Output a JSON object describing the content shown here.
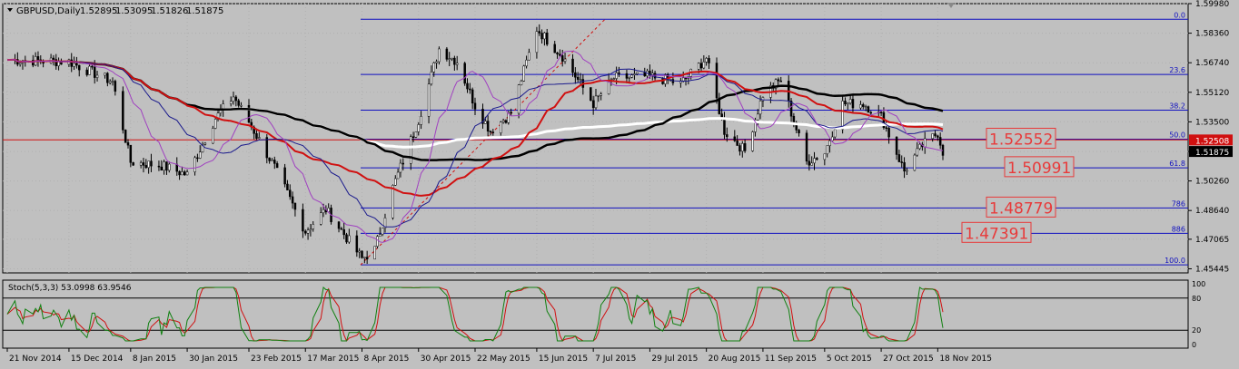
{
  "window": {
    "symbol_header": "GBPUSD,Daily",
    "ohlc": [
      "1.52895",
      "1.53095",
      "1.51826",
      "1.51875"
    ]
  },
  "colors": {
    "background": "#c0c0c0",
    "grid": "#b0b0b0",
    "bull_candle": "#000000",
    "bear_candle": "#000000",
    "ma_white": "#ffffff",
    "ma_black": "#000000",
    "ma_red": "#d01010",
    "ma_navy": "#1a1a8c",
    "ma_purple": "#a040c0",
    "fib": "#1010c0",
    "hline": "#d01010",
    "stoch_main": "#108010",
    "stoch_signal": "#d01010",
    "label_fill": "#e83a3a"
  },
  "chart_data": [
    {
      "type": "candlestick",
      "title": "GBPUSD,Daily",
      "ylim": [
        1.4522,
        1.5998
      ],
      "y_ticks": [
        "1.59980",
        "1.58360",
        "1.56740",
        "1.55120",
        "1.53500",
        "1.51875",
        "1.50260",
        "1.48640",
        "1.47065",
        "1.45445"
      ],
      "current_price_label": "1.51875",
      "bid_label": "1.52508",
      "x_ticks": [
        "21 Nov 2014",
        "15 Dec 2014",
        "8 Jan 2015",
        "30 Jan 2015",
        "23 Feb 2015",
        "17 Mar 2015",
        "8 Apr 2015",
        "30 Apr 2015",
        "22 May 2015",
        "15 Jun 2015",
        "7 Jul 2015",
        "29 Jul 2015",
        "20 Aug 2015",
        "11 Sep 2015",
        "5 Oct 2015",
        "27 Oct 2015",
        "18 Nov 2015"
      ],
      "close_path": [
        [
          "21 Nov 2014",
          1.569
        ],
        [
          "15 Dec 2014",
          1.568
        ],
        [
          "1 Jan 2015",
          1.557
        ],
        [
          "8 Jan 2015",
          1.513
        ],
        [
          "20 Jan 2015",
          1.511
        ],
        [
          "30 Jan 2015",
          1.506
        ],
        [
          "10 Feb 2015",
          1.537
        ],
        [
          "17 Feb 2015",
          1.549
        ],
        [
          "23 Feb 2015",
          1.535
        ],
        [
          "5 Mar 2015",
          1.51
        ],
        [
          "17 Mar 2015",
          1.475
        ],
        [
          "25 Mar 2015",
          1.487
        ],
        [
          "8 Apr 2015",
          1.46
        ],
        [
          "13 Apr 2015",
          1.465
        ],
        [
          "20 Apr 2015",
          1.499
        ],
        [
          "30 Apr 2015",
          1.536
        ],
        [
          "8 May 2015",
          1.575
        ],
        [
          "15 May 2015",
          1.568
        ],
        [
          "22 May 2015",
          1.544
        ],
        [
          "28 May 2015",
          1.53
        ],
        [
          "5 Jun 2015",
          1.54
        ],
        [
          "15 Jun 2015",
          1.586
        ],
        [
          "25 Jun 2015",
          1.571
        ],
        [
          "7 Jul 2015",
          1.545
        ],
        [
          "15 Jul 2015",
          1.559
        ],
        [
          "29 Jul 2015",
          1.56
        ],
        [
          "10 Aug 2015",
          1.556
        ],
        [
          "20 Aug 2015",
          1.57
        ],
        [
          "27 Aug 2015",
          1.53
        ],
        [
          "4 Sep 2015",
          1.519
        ],
        [
          "11 Sep 2015",
          1.55
        ],
        [
          "18 Sep 2015",
          1.558
        ],
        [
          "28 Sep 2015",
          1.513
        ],
        [
          "5 Oct 2015",
          1.518
        ],
        [
          "12 Oct 2015",
          1.545
        ],
        [
          "20 Oct 2015",
          1.545
        ],
        [
          "27 Oct 2015",
          1.538
        ],
        [
          "5 Nov 2015",
          1.508
        ],
        [
          "12 Nov 2015",
          1.522
        ],
        [
          "18 Nov 2015",
          1.529
        ],
        [
          "20 Nov 2015",
          1.5188
        ]
      ],
      "fibonacci": [
        {
          "label": "0.0",
          "value": 1.5912
        },
        {
          "label": "23.6",
          "value": 1.561
        },
        {
          "label": "38.2",
          "value": 1.5414
        },
        {
          "label": "50.0",
          "value": 1.5255
        },
        {
          "label": "61.8",
          "value": 1.5098
        },
        {
          "label": "786",
          "value": 1.4878
        },
        {
          "label": "886",
          "value": 1.4739
        },
        {
          "label": "100.0",
          "value": 1.4566
        }
      ],
      "horizontal_line": 1.5251,
      "price_labels": [
        "1.52552",
        "1.50991",
        "1.48779",
        "1.47391"
      ]
    },
    {
      "type": "line",
      "title": "Stoch(5,3,3) 53.0998 63.9546",
      "ylim": [
        0,
        100
      ],
      "levels": [
        80,
        20
      ],
      "y_ticks": [
        "100",
        "80",
        "20",
        "0"
      ]
    }
  ]
}
